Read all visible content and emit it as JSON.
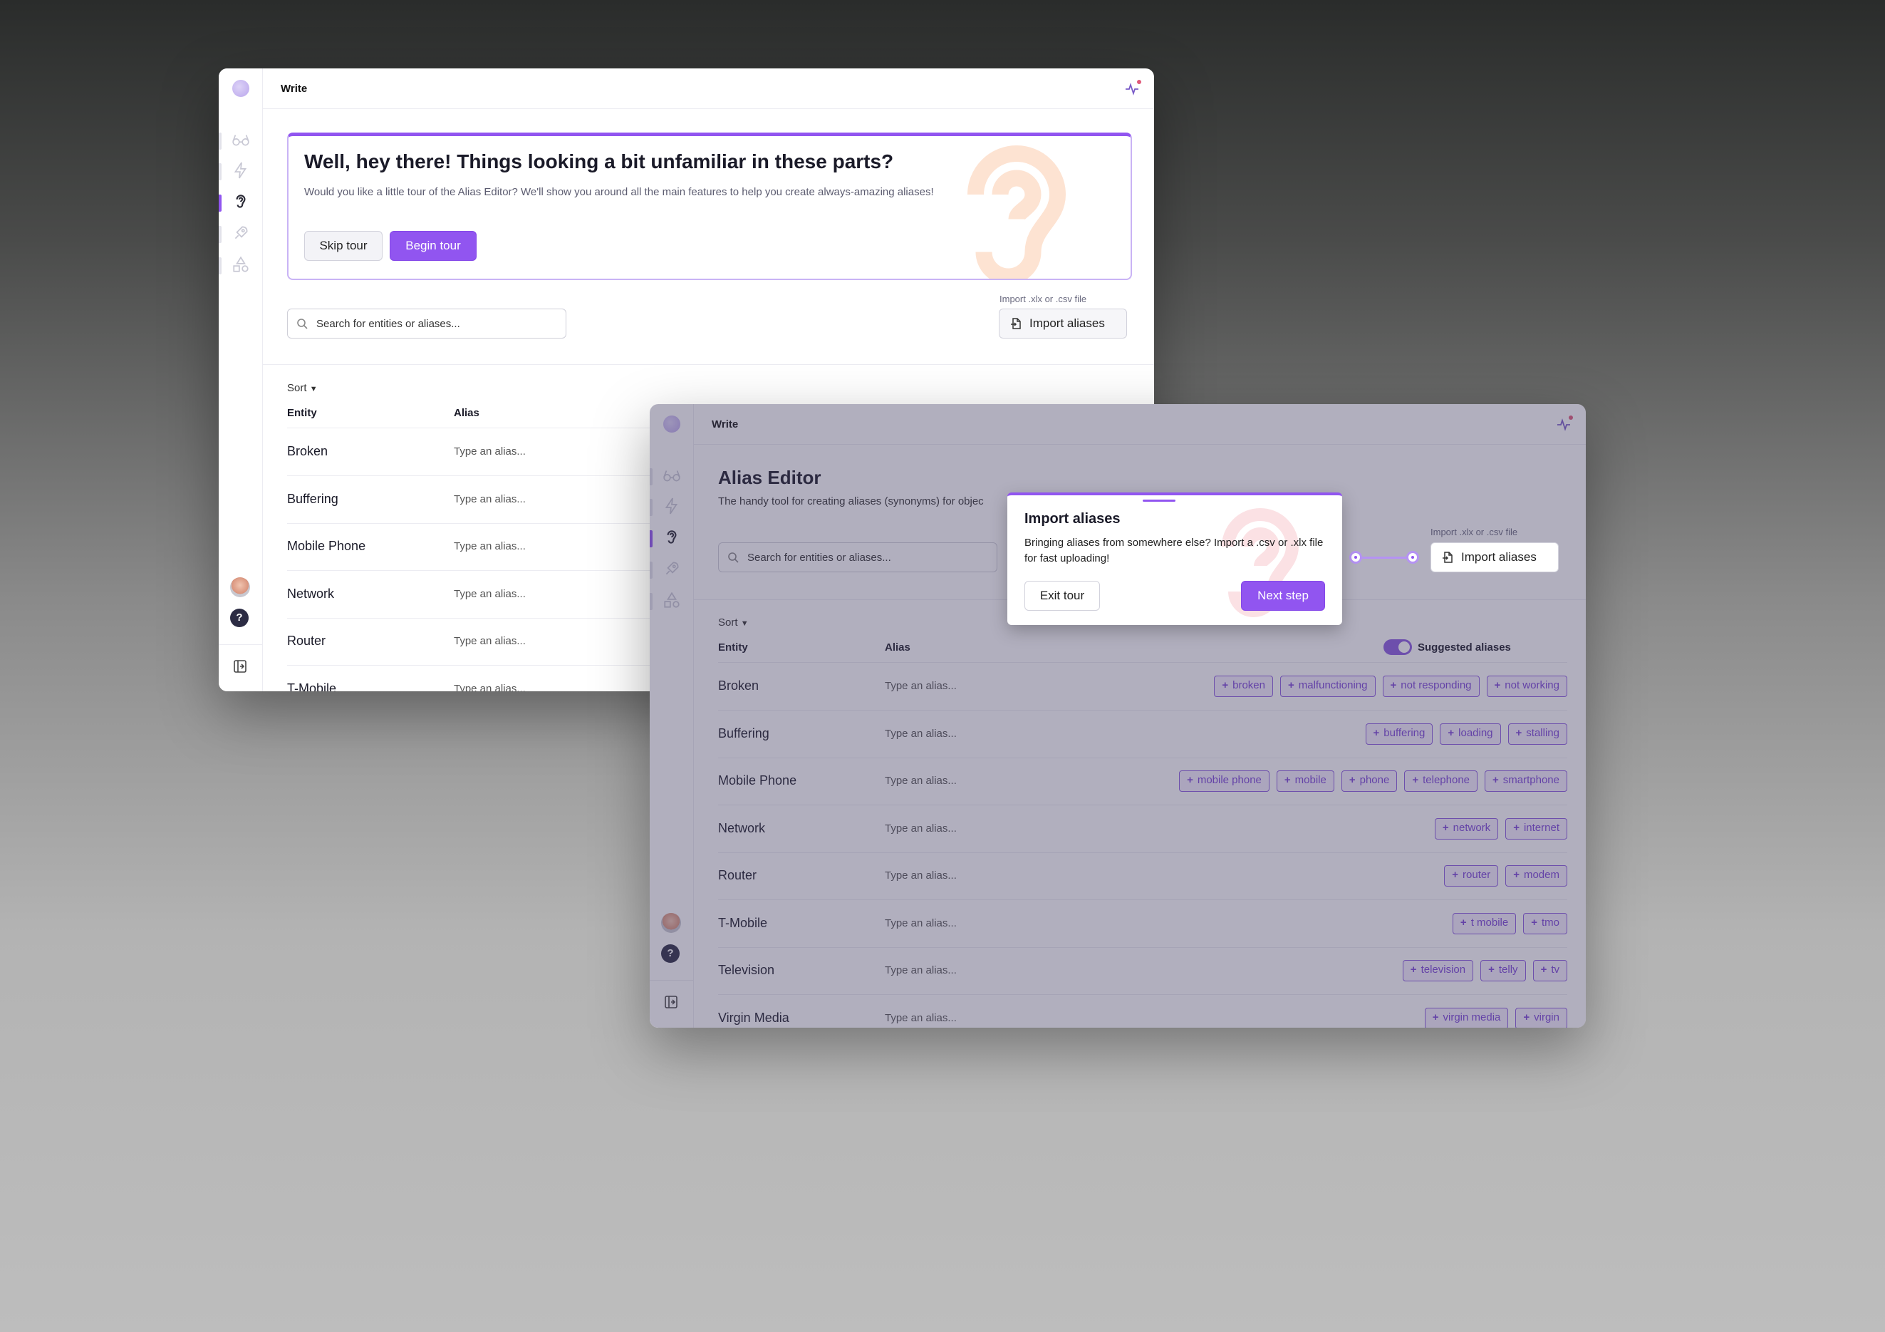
{
  "app": {
    "title": "Write"
  },
  "colors": {
    "accent": "#9155f0",
    "chip_border": "#8b5be0"
  },
  "window1": {
    "banner": {
      "title": "Well, hey there! Things looking a bit unfamiliar in these parts?",
      "text": "Would you like a little tour of the Alias Editor? We'll show you around all the main features to help you create always-amazing aliases!",
      "skip_label": "Skip tour",
      "begin_label": "Begin tour"
    },
    "search_placeholder": "Search for entities or aliases...",
    "import_hint": "Import .xlx or .csv file",
    "import_label": "Import aliases",
    "sort_label": "Sort",
    "col_entity": "Entity",
    "col_alias": "Alias",
    "rows": [
      {
        "entity": "Broken",
        "alias_placeholder": "Type an alias..."
      },
      {
        "entity": "Buffering",
        "alias_placeholder": "Type an alias..."
      },
      {
        "entity": "Mobile Phone",
        "alias_placeholder": "Type an alias..."
      },
      {
        "entity": "Network",
        "alias_placeholder": "Type an alias..."
      },
      {
        "entity": "Router",
        "alias_placeholder": "Type an alias..."
      },
      {
        "entity": "T-Mobile",
        "alias_placeholder": "Type an alias..."
      }
    ]
  },
  "window2": {
    "page_title": "Alias Editor",
    "page_subtitle": "The handy tool for creating aliases (synonyms) for objec",
    "search_placeholder": "Search for entities or aliases...",
    "import_hint": "Import .xlx or .csv file",
    "import_label": "Import aliases",
    "sort_label": "Sort",
    "col_entity": "Entity",
    "col_alias": "Alias",
    "suggested_label": "Suggested aliases",
    "popover": {
      "title": "Import aliases",
      "text": "Bringing aliases from somewhere else? Import a .csv or .xlx file for fast uploading!",
      "exit_label": "Exit tour",
      "next_label": "Next step"
    },
    "rows": [
      {
        "entity": "Broken",
        "alias_placeholder": "Type an alias...",
        "suggestions": [
          "broken",
          "malfunctioning",
          "not responding",
          "not working"
        ]
      },
      {
        "entity": "Buffering",
        "alias_placeholder": "Type an alias...",
        "suggestions": [
          "buffering",
          "loading",
          "stalling"
        ]
      },
      {
        "entity": "Mobile Phone",
        "alias_placeholder": "Type an alias...",
        "suggestions": [
          "mobile phone",
          "mobile",
          "phone",
          "telephone",
          "smartphone"
        ]
      },
      {
        "entity": "Network",
        "alias_placeholder": "Type an alias...",
        "suggestions": [
          "network",
          "internet"
        ]
      },
      {
        "entity": "Router",
        "alias_placeholder": "Type an alias...",
        "suggestions": [
          "router",
          "modem"
        ]
      },
      {
        "entity": "T-Mobile",
        "alias_placeholder": "Type an alias...",
        "suggestions": [
          "t mobile",
          "tmo"
        ]
      },
      {
        "entity": "Television",
        "alias_placeholder": "Type an alias...",
        "suggestions": [
          "television",
          "telly",
          "tv"
        ]
      },
      {
        "entity": "Virgin Media",
        "alias_placeholder": "Type an alias...",
        "suggestions": [
          "virgin media",
          "virgin"
        ]
      }
    ]
  }
}
